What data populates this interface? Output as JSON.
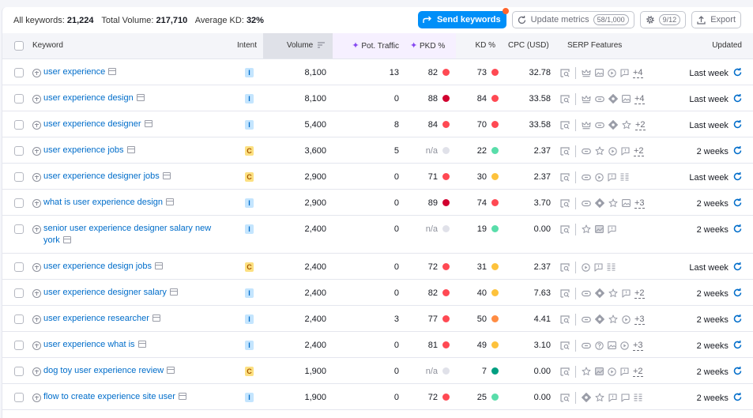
{
  "summary": {
    "all_keywords_label": "All keywords:",
    "all_keywords_value": "21,224",
    "total_volume_label": "Total Volume:",
    "total_volume_value": "217,710",
    "avg_kd_label": "Average KD:",
    "avg_kd_value": "32%"
  },
  "toolbar": {
    "send_keywords": "Send keywords",
    "update_metrics": "Update metrics",
    "update_metrics_count": "58/1,000",
    "settings_count": "9/12",
    "export": "Export",
    "colors": {
      "primary": "#008ff8",
      "notification_dot": "#ff642d"
    }
  },
  "columns": {
    "keyword": "Keyword",
    "intent": "Intent",
    "volume": "Volume",
    "pot_traffic": "Pot. Traffic",
    "pkd": "PKD %",
    "kd": "KD %",
    "cpc": "CPC (USD)",
    "serp": "SERP Features",
    "updated": "Updated"
  },
  "dot_colors": {
    "very_hard": "#d1002f",
    "hard": "#ff4953",
    "difficult": "#ff8c43",
    "possible": "#fdc23c",
    "easy": "#59ddaa",
    "very_easy": "#009f81",
    "na": "#e0e1e9"
  },
  "rows": [
    {
      "keyword": "user experience",
      "intent": "I",
      "volume": "8,100",
      "pot_traffic": "13",
      "pkd": "82",
      "pkd_color": "hard",
      "kd": "73",
      "kd_color": "hard",
      "cpc": "32.78",
      "serp": [
        "crown",
        "image",
        "video",
        "review"
      ],
      "serp_more": "+4",
      "updated": "Last week"
    },
    {
      "keyword": "user experience design",
      "intent": "I",
      "volume": "8,100",
      "pot_traffic": "0",
      "pkd": "88",
      "pkd_color": "very_hard",
      "kd": "84",
      "kd_color": "hard",
      "cpc": "33.58",
      "serp": [
        "crown",
        "link",
        "diamond",
        "image"
      ],
      "serp_more": "+4",
      "updated": "Last week"
    },
    {
      "keyword": "user experience designer",
      "intent": "I",
      "volume": "5,400",
      "pot_traffic": "8",
      "pkd": "84",
      "pkd_color": "hard",
      "kd": "70",
      "kd_color": "hard",
      "cpc": "33.58",
      "serp": [
        "crown",
        "link",
        "diamond",
        "star"
      ],
      "serp_more": "+2",
      "updated": "Last week"
    },
    {
      "keyword": "user experience jobs",
      "intent": "C",
      "volume": "3,600",
      "pot_traffic": "5",
      "pkd": "n/a",
      "pkd_color": "na",
      "kd": "22",
      "kd_color": "easy",
      "cpc": "2.37",
      "serp": [
        "link",
        "star",
        "video",
        "review"
      ],
      "serp_more": "+2",
      "updated": "2 weeks"
    },
    {
      "keyword": "user experience designer jobs",
      "intent": "C",
      "volume": "2,900",
      "pot_traffic": "0",
      "pkd": "71",
      "pkd_color": "hard",
      "kd": "30",
      "kd_color": "possible",
      "cpc": "2.37",
      "serp": [
        "link",
        "video",
        "review",
        "list"
      ],
      "serp_more": "",
      "updated": "Last week"
    },
    {
      "keyword": "what is user experience design",
      "intent": "I",
      "volume": "2,900",
      "pot_traffic": "0",
      "pkd": "89",
      "pkd_color": "very_hard",
      "kd": "74",
      "kd_color": "hard",
      "cpc": "3.70",
      "serp": [
        "link",
        "diamond",
        "star",
        "image"
      ],
      "serp_more": "+3",
      "updated": "2 weeks"
    },
    {
      "keyword": "senior user experience designer salary new york",
      "intent": "I",
      "volume": "2,400",
      "pot_traffic": "0",
      "pkd": "n/a",
      "pkd_color": "na",
      "kd": "19",
      "kd_color": "easy",
      "cpc": "0.00",
      "serp": [
        "star",
        "image-check",
        "review"
      ],
      "serp_more": "",
      "updated": "2 weeks",
      "tall": true
    },
    {
      "keyword": "user experience design jobs",
      "intent": "C",
      "volume": "2,400",
      "pot_traffic": "0",
      "pkd": "72",
      "pkd_color": "hard",
      "kd": "31",
      "kd_color": "possible",
      "cpc": "2.37",
      "serp": [
        "video",
        "review",
        "list"
      ],
      "serp_more": "",
      "updated": "Last week"
    },
    {
      "keyword": "user experience designer salary",
      "intent": "I",
      "volume": "2,400",
      "pot_traffic": "0",
      "pkd": "82",
      "pkd_color": "hard",
      "kd": "40",
      "kd_color": "possible",
      "cpc": "7.63",
      "serp": [
        "link",
        "diamond",
        "star",
        "review"
      ],
      "serp_more": "+2",
      "updated": "2 weeks"
    },
    {
      "keyword": "user experience researcher",
      "intent": "I",
      "volume": "2,400",
      "pot_traffic": "3",
      "pkd": "77",
      "pkd_color": "hard",
      "kd": "50",
      "kd_color": "difficult",
      "cpc": "4.41",
      "serp": [
        "link",
        "diamond",
        "star",
        "video"
      ],
      "serp_more": "+3",
      "updated": "2 weeks"
    },
    {
      "keyword": "user experience what is",
      "intent": "I",
      "volume": "2,400",
      "pot_traffic": "0",
      "pkd": "81",
      "pkd_color": "hard",
      "kd": "49",
      "kd_color": "possible",
      "cpc": "3.10",
      "serp": [
        "link",
        "question",
        "image",
        "video"
      ],
      "serp_more": "+3",
      "updated": "2 weeks"
    },
    {
      "keyword": "dog toy user experience review",
      "intent": "C",
      "volume": "1,900",
      "pot_traffic": "0",
      "pkd": "n/a",
      "pkd_color": "na",
      "kd": "7",
      "kd_color": "very_easy",
      "cpc": "0.00",
      "serp": [
        "star",
        "image-check",
        "video",
        "review"
      ],
      "serp_more": "+2",
      "updated": "2 weeks"
    },
    {
      "keyword": "flow to create experience site user",
      "intent": "I",
      "volume": "1,900",
      "pot_traffic": "0",
      "pkd": "72",
      "pkd_color": "hard",
      "kd": "25",
      "kd_color": "easy",
      "cpc": "0.00",
      "serp": [
        "diamond",
        "star",
        "review",
        "comment",
        "list"
      ],
      "serp_more": "",
      "updated": "2 weeks"
    }
  ]
}
